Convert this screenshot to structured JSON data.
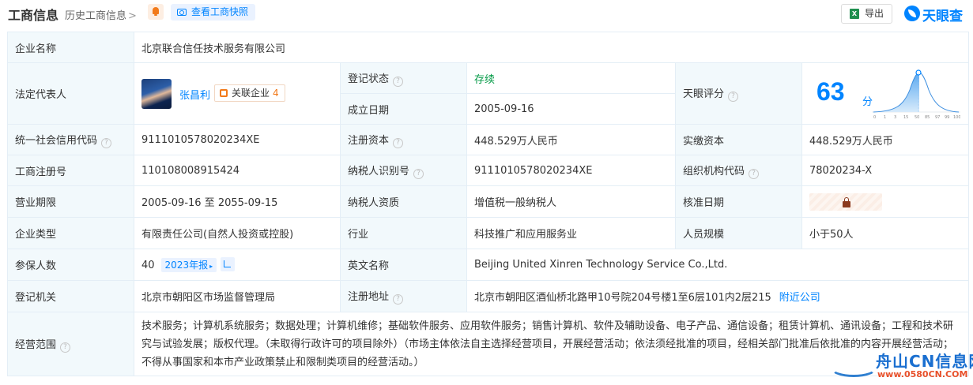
{
  "header": {
    "title": "工商信息",
    "history_link": "历史工商信息",
    "snapshot_button": "查看工商快照",
    "export_button": "导出",
    "export_icon": "X",
    "logo_text": "天眼查"
  },
  "rows": {
    "company_name": {
      "label": "企业名称",
      "value": "北京联合信任技术服务有限公司"
    },
    "legal_rep": {
      "label": "法定代表人",
      "name": "张昌利",
      "assoc_label": "关联企业",
      "assoc_count": "4"
    },
    "reg_status": {
      "label": "登记状态",
      "value": "存续"
    },
    "est_date": {
      "label": "成立日期",
      "value": "2005-09-16"
    },
    "tianyan_score": {
      "label": "天眼评分",
      "value": "63",
      "unit": "分",
      "curve_ticks": [
        "0",
        "1",
        "3",
        "15",
        "50",
        "85",
        "97",
        "99",
        "100"
      ]
    },
    "credit_code": {
      "label": "统一社会信用代码",
      "value": "9111010578020234XE"
    },
    "reg_capital": {
      "label": "注册资本",
      "value": "448.529万人民币"
    },
    "paid_capital": {
      "label": "实缴资本",
      "value": "448.529万人民币"
    },
    "reg_number": {
      "label": "工商注册号",
      "value": "110108008915424"
    },
    "taxpayer_id": {
      "label": "纳税人识别号",
      "value": "9111010578020234XE"
    },
    "org_code": {
      "label": "组织机构代码",
      "value": "78020234-X"
    },
    "term": {
      "label": "营业期限",
      "value": "2005-09-16 至 2055-09-15"
    },
    "taxpayer_qual": {
      "label": "纳税人资质",
      "value": "增值税一般纳税人"
    },
    "approval_date": {
      "label": "核准日期"
    },
    "company_type": {
      "label": "企业类型",
      "value": "有限责任公司(自然人投资或控股)"
    },
    "industry": {
      "label": "行业",
      "value": "科技推广和应用服务业"
    },
    "staff_size": {
      "label": "人员规模",
      "value": "小于50人"
    },
    "insured": {
      "label": "参保人数",
      "value": "40",
      "report": "2023年报"
    },
    "english_name": {
      "label": "英文名称",
      "value": "Beijing United Xinren Technology Service Co.,Ltd."
    },
    "reg_authority": {
      "label": "登记机关",
      "value": "北京市朝阳区市场监督管理局"
    },
    "reg_address": {
      "label": "注册地址",
      "value": "北京市朝阳区酒仙桥北路甲10号院204号楼1至6层101内2层215",
      "nearby": "附近公司"
    },
    "scope": {
      "label": "经营范围",
      "value": "技术服务；计算机系统服务；数据处理；计算机维修；基础软件服务、应用软件服务；销售计算机、软件及辅助设备、电子产品、通信设备；租赁计算机、通讯设备；工程和技术研究与试验发展；版权代理。（未取得行政许可的项目除外）（市场主体依法自主选择经营项目，开展经营活动；依法须经批准的项目，经相关部门批准后依批准的内容开展经营活动；不得从事国家和本市产业政策禁止和限制类项目的经营活动。）"
    }
  },
  "watermark": {
    "text": "舟山CN信息网",
    "url": "www.0580CN.COM"
  },
  "colors": {
    "accent": "#0084ff",
    "label_bg": "#f2f9fc",
    "border": "#e4eef6",
    "status_green": "#009944",
    "orange": "#f27a1a"
  }
}
